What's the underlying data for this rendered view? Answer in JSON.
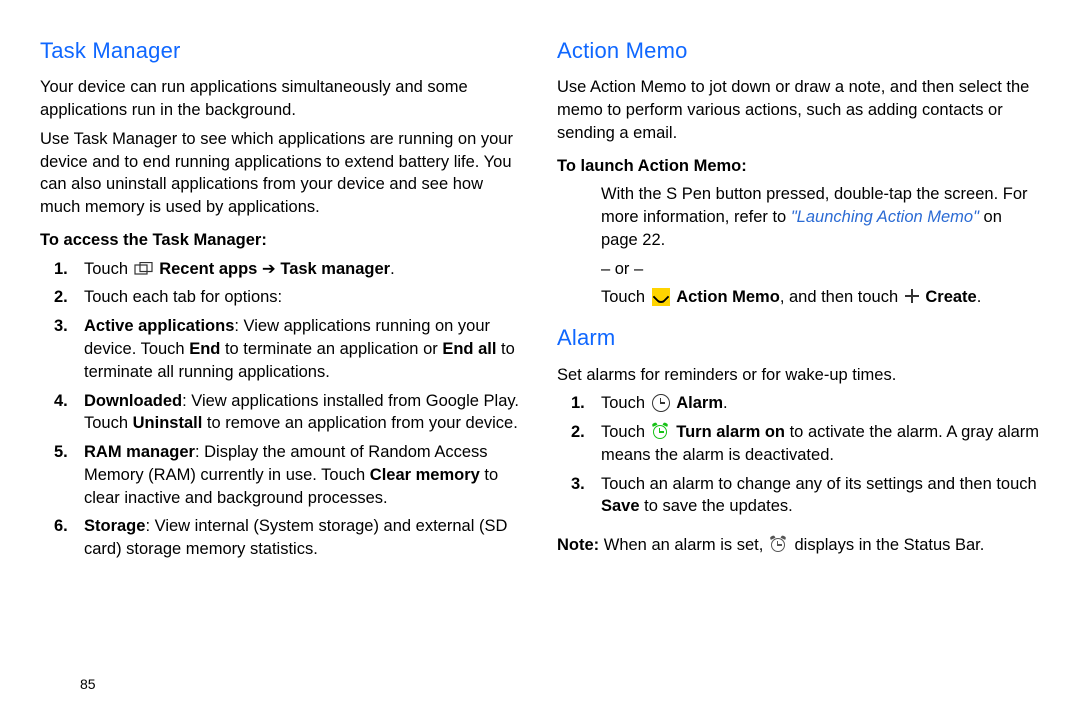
{
  "page_number": "85",
  "left": {
    "heading": "Task Manager",
    "p1": "Your device can run applications simultaneously and some applications run in the background.",
    "p2": "Use Task Manager to see which applications are running on your device and to end running applications to extend battery life. You can also uninstall applications from your device and see how much memory is used by applications.",
    "sub": "To access the Task Manager:",
    "items": {
      "n1": "1.",
      "t1_a": "Touch",
      "t1_b": "Recent apps",
      "t1_sep": " ➔ ",
      "t1_c": "Task manager",
      "t1_d": ".",
      "n2": "2.",
      "t2": "Touch each tab for options:",
      "n3": "3.",
      "t3_b1": "Active applications",
      "t3_a": ": View applications running on your device. Touch ",
      "t3_b2": "End",
      "t3_b": " to terminate an application or ",
      "t3_b3": "End all",
      "t3_c": " to terminate all running applications.",
      "n4": "4.",
      "t4_b1": "Downloaded",
      "t4_a": ": View applications installed from Google Play. Touch ",
      "t4_b2": "Uninstall",
      "t4_b": " to remove an application from your device.",
      "n5": "5.",
      "t5_b1": "RAM manager",
      "t5_a": ": Display the amount of Random Access Memory (RAM) currently in use. Touch ",
      "t5_b2": "Clear memory",
      "t5_b": " to clear inactive and background processes.",
      "n6": "6.",
      "t6_b1": "Storage",
      "t6_a": ": View internal (System storage) and external (SD card) storage memory statistics."
    }
  },
  "right": {
    "heading1": "Action Memo",
    "p1": "Use Action Memo to jot down or draw a note, and then select the memo to perform various actions, such as adding contacts or sending a email.",
    "sub1": "To launch Action Memo:",
    "am": {
      "line1": "With the S Pen button pressed, double-tap the screen. For more information, refer to ",
      "ref_i": "\"Launching Action Memo\"",
      "ref_tail": " on page 22.",
      "or": "– or –",
      "t_pre": "Touch",
      "bold_am": "Action Memo",
      "mid": ", and then touch",
      "bold_create": "Create",
      "dot": "."
    },
    "heading2": "Alarm",
    "p2": "Set alarms for reminders or for wake-up times.",
    "alarm": {
      "n1": "1.",
      "t1_pre": "Touch",
      "t1_b": "Alarm",
      "t1_dot": ".",
      "n2": "2.",
      "t2_pre": "Touch",
      "t2_b": "Turn alarm on",
      "t2_post": " to activate the alarm. A gray alarm means the alarm is deactivated.",
      "n3": "3.",
      "t3_a": "Touch an alarm to change any of its settings and then touch ",
      "t3_b": "Save",
      "t3_c": " to save the updates."
    },
    "note_b": "Note:",
    "note_a": " When an alarm is set, ",
    "note_c": " displays in the Status Bar."
  }
}
